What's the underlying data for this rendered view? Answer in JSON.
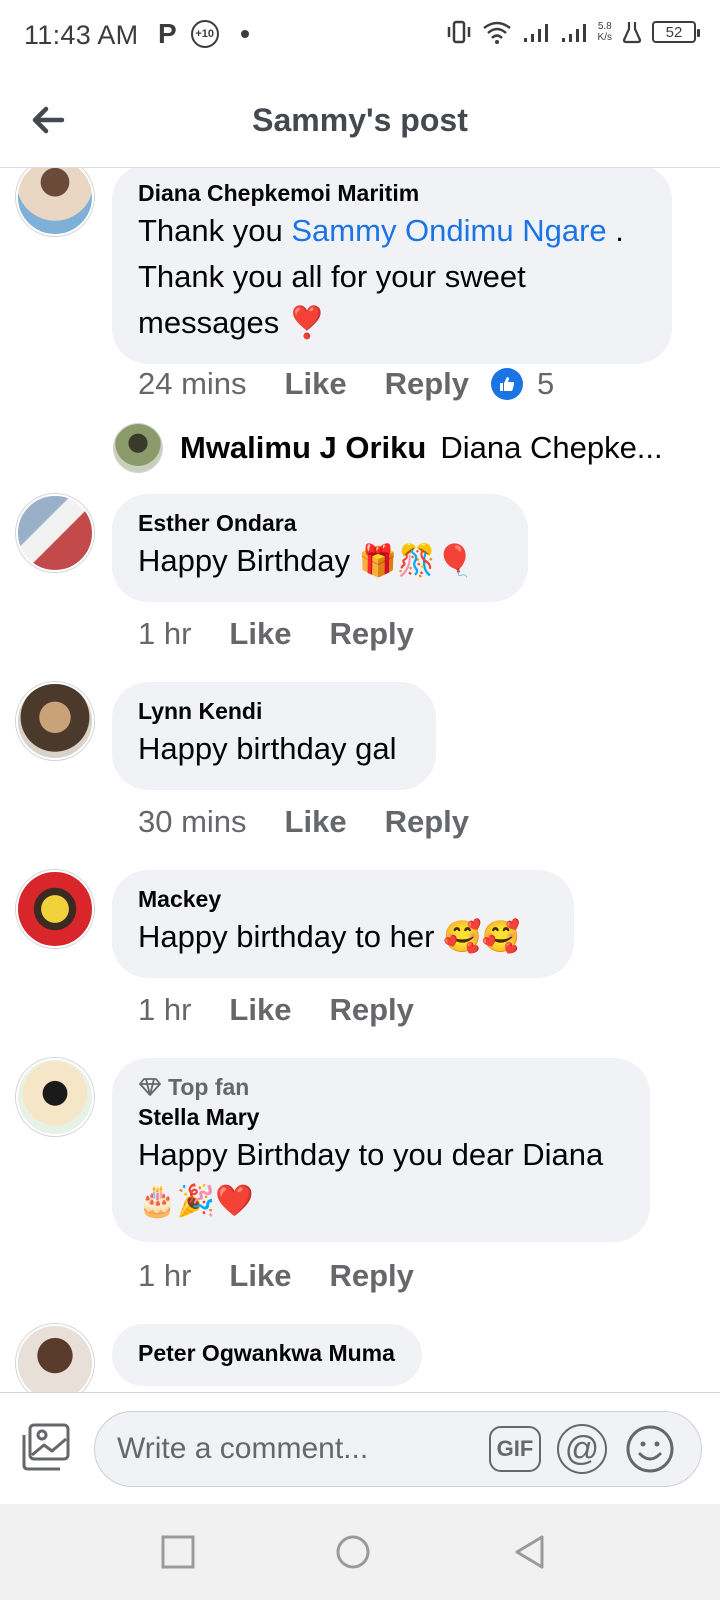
{
  "status_bar": {
    "time": "11:43 AM",
    "p_label": "P",
    "notification_badge": "+10",
    "net_speed_value": "5.8",
    "net_speed_unit": "K/s",
    "battery": "52"
  },
  "header": {
    "title": "Sammy's post"
  },
  "comments": [
    {
      "author": "Diana Chepkemoi Maritim",
      "text_before": "Thank you ",
      "mention": "Sammy Ondimu Ngare",
      "text_after": " . Thank you all for your sweet messages ❣️",
      "time": "24 mins",
      "like_label": "Like",
      "reply_label": "Reply",
      "reaction_count": "5"
    },
    {
      "author": "Esther Ondara",
      "text": "Happy Birthday 🎁🎊🎈",
      "time": "1 hr",
      "like_label": "Like",
      "reply_label": "Reply"
    },
    {
      "author": "Lynn Kendi",
      "text": "Happy birthday gal",
      "time": "30 mins",
      "like_label": "Like",
      "reply_label": "Reply"
    },
    {
      "author": "Mackey",
      "text": "Happy birthday to her 🥰🥰",
      "time": "1 hr",
      "like_label": "Like",
      "reply_label": "Reply"
    },
    {
      "badge": "Top fan",
      "author": "Stella Mary",
      "text": "Happy Birthday to you dear Diana 🎂🎉❤️",
      "time": "1 hr",
      "like_label": "Like",
      "reply_label": "Reply"
    },
    {
      "author": "Peter Ogwankwa Muma"
    }
  ],
  "reply_preview": {
    "author": "Mwalimu J Oriku",
    "snippet": "Diana Chepke..."
  },
  "composer": {
    "placeholder": "Write a comment...",
    "gif_label": "GIF",
    "mention_label": "@"
  },
  "colors": {
    "mention": "#1b74e4",
    "bubble": "#f0f2f5",
    "secondary_text": "#65676b"
  }
}
